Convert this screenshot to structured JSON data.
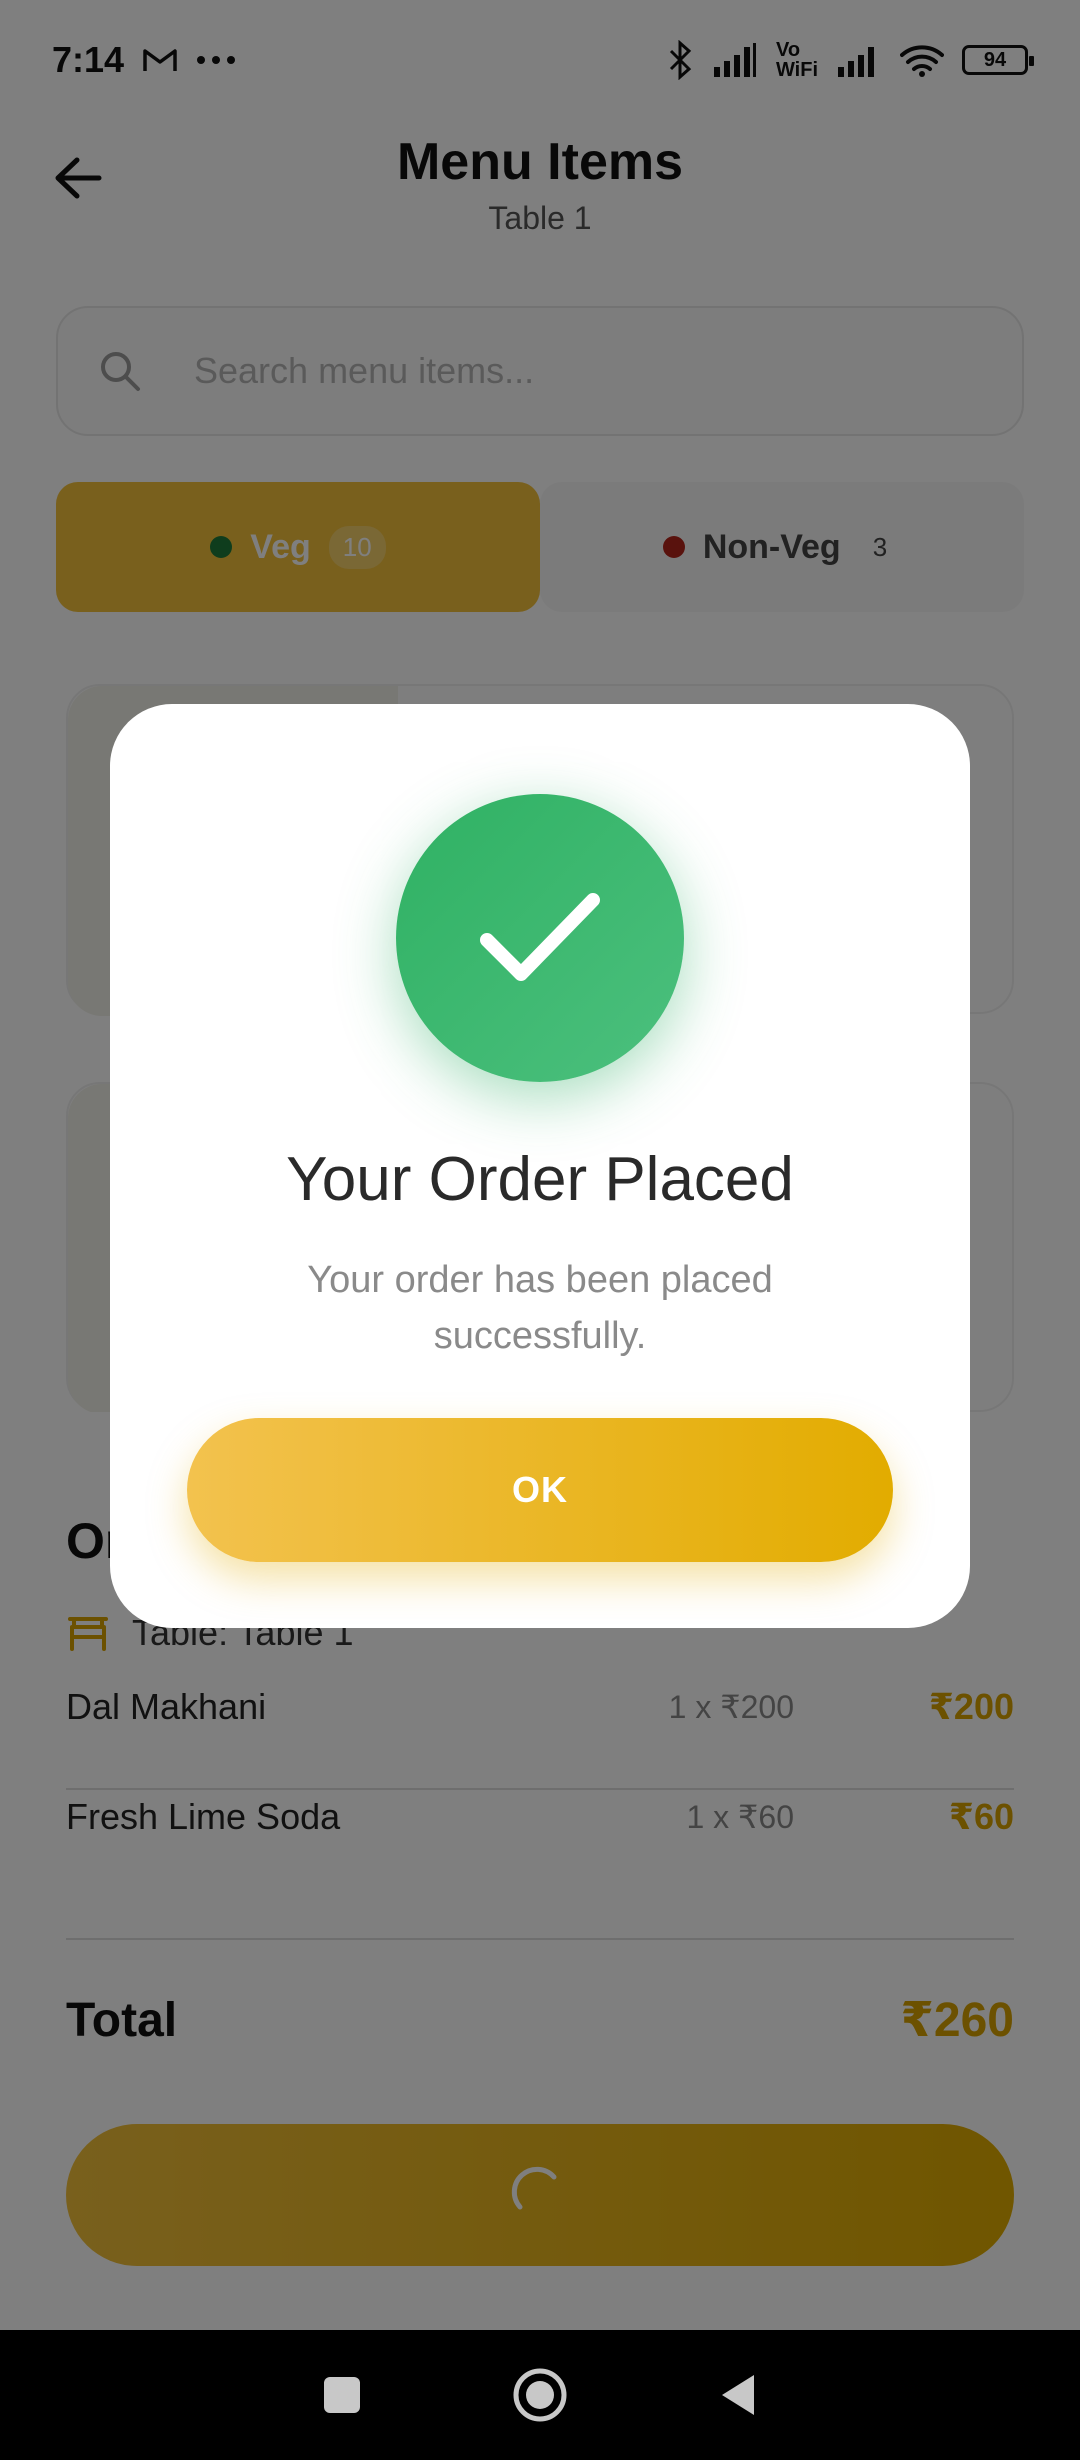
{
  "status_bar": {
    "time": "7:14",
    "battery": "94",
    "icons": [
      "gmail-icon",
      "more-dots-icon",
      "bluetooth-icon",
      "signal-icon",
      "vowifi-icon",
      "signal-icon",
      "wifi-icon",
      "battery-icon"
    ],
    "vowifi_top": "Vo",
    "vowifi_bottom": "WiFi"
  },
  "header": {
    "title": "Menu Items",
    "subtitle": "Table 1"
  },
  "search": {
    "placeholder": "Search menu items..."
  },
  "tabs": [
    {
      "label": "Veg",
      "count": "10",
      "dot_color": "#1f7a3a"
    },
    {
      "label": "Non-Veg",
      "count": "3",
      "dot_color": "#b3241a"
    }
  ],
  "order_sheet": {
    "title": "Or",
    "table_label": "Table: Table 1",
    "items": [
      {
        "name": "Dal Makhani",
        "qty": "1 x ₹200",
        "amount": "₹200"
      },
      {
        "name": "Fresh Lime Soda",
        "qty": "1 x ₹60",
        "amount": "₹60"
      }
    ],
    "total_label": "Total",
    "total_amount": "₹260"
  },
  "dialog": {
    "title": "Your Order Placed",
    "message": "Your order has been placed successfully.",
    "ok_label": "OK"
  },
  "colors": {
    "accent": "#f2c03a",
    "success": "#2fb163",
    "amount": "#d9a300"
  }
}
